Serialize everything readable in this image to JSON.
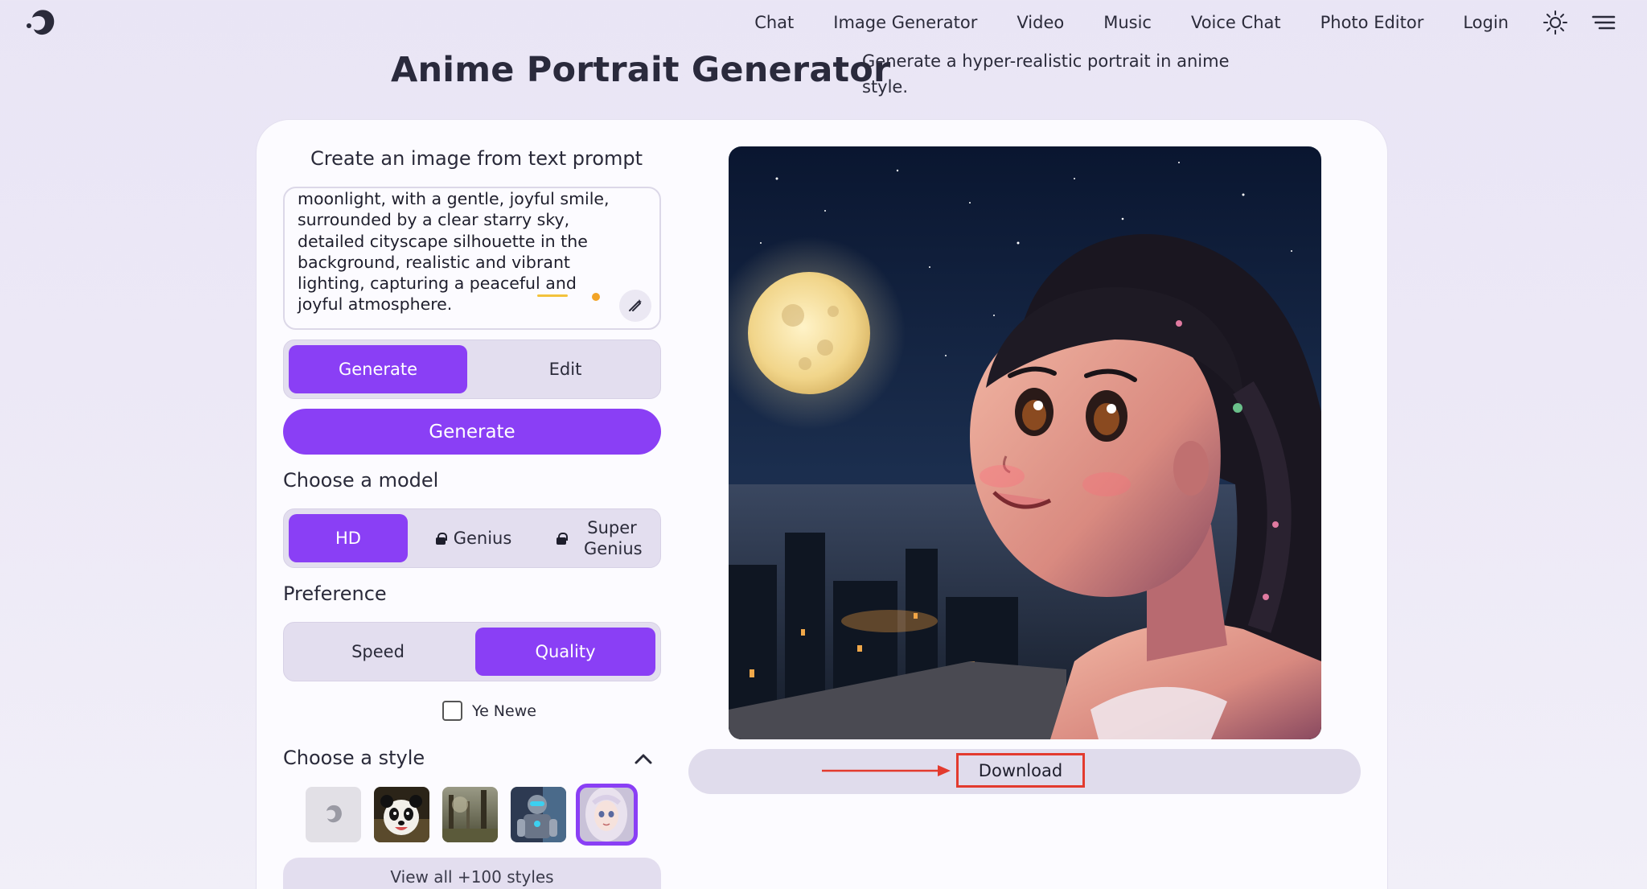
{
  "nav": {
    "items": [
      "Chat",
      "Image Generator",
      "Video",
      "Music",
      "Voice Chat",
      "Photo Editor",
      "Login"
    ]
  },
  "header": {
    "title": "Anime Portrait Generator",
    "subtitle": "Generate a hyper-realistic portrait in anime style."
  },
  "prompt": {
    "heading": "Create an image from text prompt",
    "value": "moonlight, with a gentle, joyful smile, surrounded by a clear starry sky, detailed cityscape silhouette in the background, realistic and vibrant lighting, capturing a peaceful and joyful atmosphere."
  },
  "mode_tabs": {
    "generate": "Generate",
    "edit": "Edit",
    "active": "Generate"
  },
  "generate_button": "Generate",
  "model": {
    "label": "Choose a model",
    "options": [
      "HD",
      "Genius",
      "Super Genius"
    ],
    "selected": "HD",
    "locked": [
      "Genius",
      "Super Genius"
    ]
  },
  "preference": {
    "label": "Preference",
    "options": [
      "Speed",
      "Quality"
    ],
    "selected": "Quality"
  },
  "checkbox": {
    "label": "Ye Newe",
    "checked": false
  },
  "styles": {
    "label": "Choose a style",
    "thumbnails": [
      "default-logo",
      "panda",
      "forest",
      "robot",
      "anime-girl"
    ],
    "selected": "anime-girl",
    "view_all": "View all +100 styles"
  },
  "download": {
    "label": "Download"
  },
  "colors": {
    "accent": "#8a3ff5",
    "highlight": "#e33b2e"
  }
}
